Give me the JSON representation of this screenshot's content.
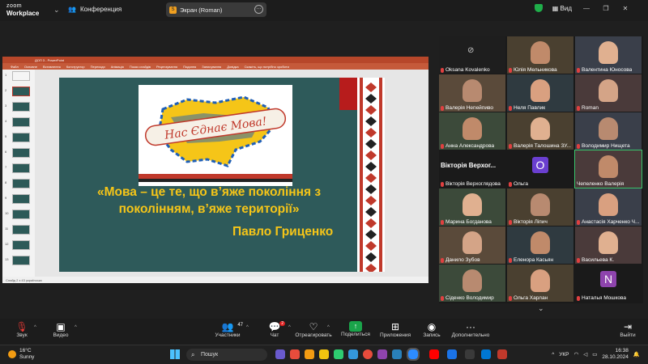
{
  "app": {
    "brand_line1": "zoom",
    "brand_line2": "Workplace",
    "meeting_name": "Конференция"
  },
  "screen_share": {
    "label": "Экран (Roman)"
  },
  "topbar_right": {
    "view_label": "Вид"
  },
  "presentation": {
    "quote": "«Мова – це те, що в’яже покоління з поколінням, в’яже території»",
    "author": "Павло Гриценко",
    "banner_text": "Нас Єднає Мова!",
    "window_title": "ДОП 3 - PowerPoint",
    "ribbon_tabs": [
      "Файл",
      "Основне",
      "Вставлення",
      "Конструктор",
      "Переходи",
      "Анімація",
      "Показ слайдів",
      "Рецензування",
      "Подання",
      "Записування",
      "Довідка",
      "Скажіть, що потрібно зробити"
    ],
    "status": "Слайд 2 з 43   українська",
    "thumb_count": 13
  },
  "participants": [
    {
      "name": "Oksana Kovalenko",
      "muted": true,
      "type": "video-off"
    },
    {
      "name": "Юлія Мельникова",
      "muted": true,
      "type": "video"
    },
    {
      "name": "Валентина Юносова",
      "muted": true,
      "type": "video"
    },
    {
      "name": "Валерія Непейпиво",
      "muted": true,
      "type": "video"
    },
    {
      "name": "Неля Павлик",
      "muted": true,
      "type": "video"
    },
    {
      "name": "Roman",
      "muted": true,
      "type": "video"
    },
    {
      "name": "Анна Александрова",
      "muted": true,
      "type": "video"
    },
    {
      "name": "Валерія Талошина ЗУ...",
      "muted": true,
      "type": "video"
    },
    {
      "name": "Володимир Нищета",
      "muted": true,
      "type": "video"
    },
    {
      "name": "Вікторія Верхоглядова",
      "muted": true,
      "type": "name"
    },
    {
      "name": "Ольга",
      "muted": true,
      "type": "avatar",
      "initial": "O",
      "color": "#6a3fd0"
    },
    {
      "name": "Чепеленко Валерія",
      "muted": false,
      "type": "video"
    },
    {
      "name": "Марина Богданова",
      "muted": true,
      "type": "video"
    },
    {
      "name": "Вікторія Лiпич",
      "muted": true,
      "type": "video"
    },
    {
      "name": "Анастасія Харченко Ч...",
      "muted": true,
      "type": "video"
    },
    {
      "name": "Данило Зубов",
      "muted": true,
      "type": "video"
    },
    {
      "name": "Еленора Касьян",
      "muted": true,
      "type": "video"
    },
    {
      "name": "Васильева К.",
      "muted": true,
      "type": "video"
    },
    {
      "name": "Сіденко Володимир",
      "muted": true,
      "type": "video"
    },
    {
      "name": "Ольга Харлан",
      "muted": true,
      "type": "video"
    },
    {
      "name": "Наталья Мошкова",
      "muted": true,
      "type": "avatar",
      "initial": "N",
      "color": "#8e44ad"
    }
  ],
  "gallery_caption": "Вікторія Верхог...",
  "toolbar": {
    "audio": "Звук",
    "video": "Видео",
    "participants": "Участники",
    "participants_count": "47",
    "chat": "Чат",
    "chat_badge": "2",
    "react": "Отреагировать",
    "share": "Поделиться",
    "apps": "Приложения",
    "record": "Запись",
    "more": "Дополнительно",
    "leave": "Выйти"
  },
  "taskbar": {
    "temp": "16°C",
    "weather": "Sunny",
    "search": "Пошук",
    "lang": "УКР",
    "time": "16:38",
    "date": "28.10.2024"
  },
  "colors": {
    "accent_green": "#1aa34a",
    "slide_bg": "#2e5a5a",
    "quote": "#f5c518"
  }
}
